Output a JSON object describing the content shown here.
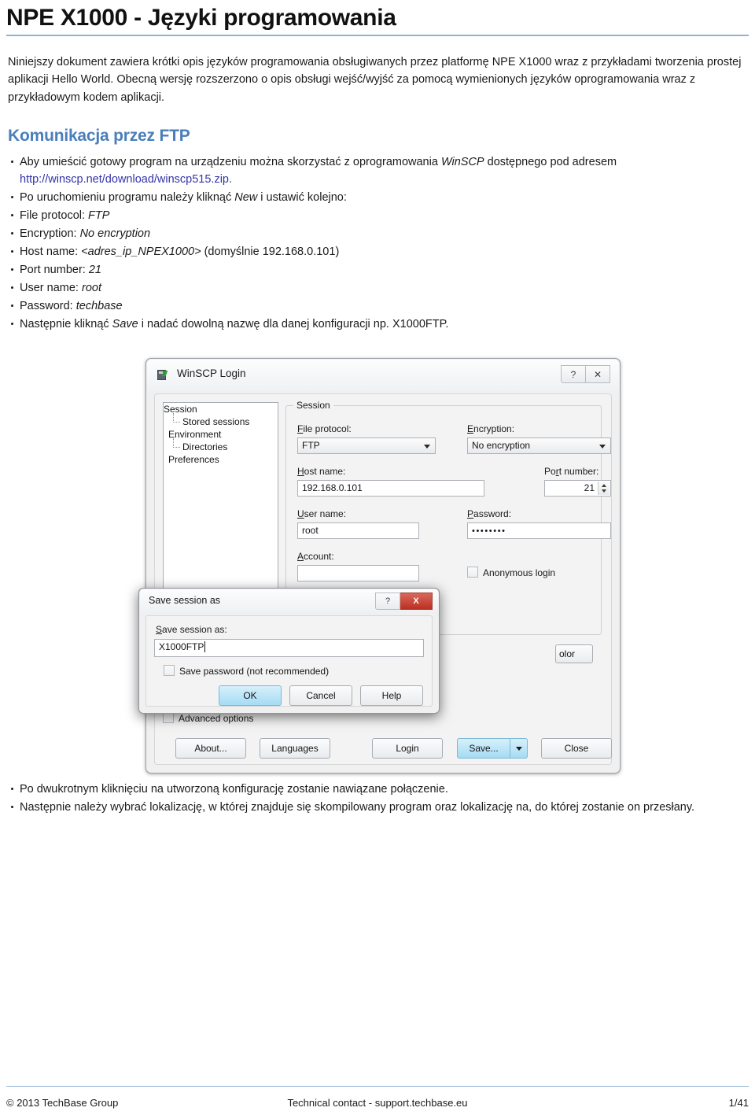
{
  "document": {
    "title": "NPE X1000 - Języki programowania",
    "intro": "Niniejszy dokument zawiera krótki opis języków programowania obsługiwanych przez platformę NPE X1000 wraz z przykładami tworzenia prostej aplikacji Hello World. Obecną wersję rozszerzono o opis obsługi wejść/wyjść za pomocą wymienionych języków oprogramowania wraz z przykładowym kodem aplikacji."
  },
  "section": {
    "heading": "Komunikacja przez FTP",
    "bullets": {
      "b1_pre": "Aby umieścić gotowy program na urządzeniu można skorzystać z oprogramowania ",
      "b1_italic": "WinSCP",
      "b1_post": " dostępnego pod adresem ",
      "b1_link": "http://winscp.net/download/winscp515.zip",
      "b1_end": ".",
      "b2_pre": "Po uruchomieniu programu należy kliknąć ",
      "b2_italic": "New",
      "b2_post": " i ustawić kolejno:",
      "b3_pre": "File protocol: ",
      "b3_italic": "FTP",
      "b4_pre": "Encryption: ",
      "b4_italic": "No encryption",
      "b5_pre": "Host name: ",
      "b5_italic": "<adres_ip_NPEX1000>",
      "b5_post": " (domyślnie 192.168.0.101)",
      "b6_pre": "Port number: ",
      "b6_italic": "21",
      "b7_pre": "User name: ",
      "b7_italic": "root",
      "b8_pre": "Password: ",
      "b8_italic": "techbase",
      "b9_pre": "Następnie kliknąć ",
      "b9_italic": "Save",
      "b9_post": " i nadać dowolną nazwę dla danej konfiguracji np. X1000FTP."
    },
    "tail_bullets": [
      "Po dwukrotnym kliknięciu na utworzoną konfigurację zostanie nawiązane połączenie.",
      "Następnie należy wybrać lokalizację, w której znajduje się skompilowany program oraz lokalizację na, do której zostanie on przesłany."
    ]
  },
  "winscp": {
    "window_title": "WinSCP Login",
    "title_icon": "winscp-app-icon",
    "help_button": "?",
    "close_button": "✕",
    "tree": {
      "session": "Session",
      "stored_sessions": "Stored sessions",
      "environment": "Environment",
      "directories": "Directories",
      "preferences": "Preferences"
    },
    "group_title": "Session",
    "labels": {
      "file_protocol": "File protocol:",
      "encryption": "Encryption:",
      "host_name": "Host name:",
      "port_number": "Port number:",
      "user_name": "User name:",
      "password": "Password:",
      "account": "Account:",
      "anonymous_login": "Anonymous login",
      "advanced_options": "Advanced options"
    },
    "values": {
      "file_protocol": "FTP",
      "encryption": "No encryption",
      "host_name": "192.168.0.101",
      "port_number": "21",
      "user_name": "root",
      "password": "••••••••",
      "account": ""
    },
    "buttons": {
      "about": "About...",
      "languages": "Languages",
      "login": "Login",
      "save": "Save...",
      "close": "Close",
      "color_partial": "olor"
    }
  },
  "save_dialog": {
    "window_title": "Save session as",
    "help_button": "?",
    "close_button": "X",
    "field_label": "Save session as:",
    "field_value": "X1000FTP",
    "checkbox_label": "Save password (not recommended)",
    "ok": "OK",
    "cancel": "Cancel",
    "help": "Help"
  },
  "footer": {
    "left": "© 2013 TechBase Group",
    "center": "Technical contact - support.techbase.eu",
    "right": "1/41"
  },
  "colors": {
    "rule": "#8fb4d4",
    "heading": "#4a7ebb",
    "link": "#3333aa",
    "accent_blue": "#a5dcf4",
    "close_red": "#bb3022"
  }
}
